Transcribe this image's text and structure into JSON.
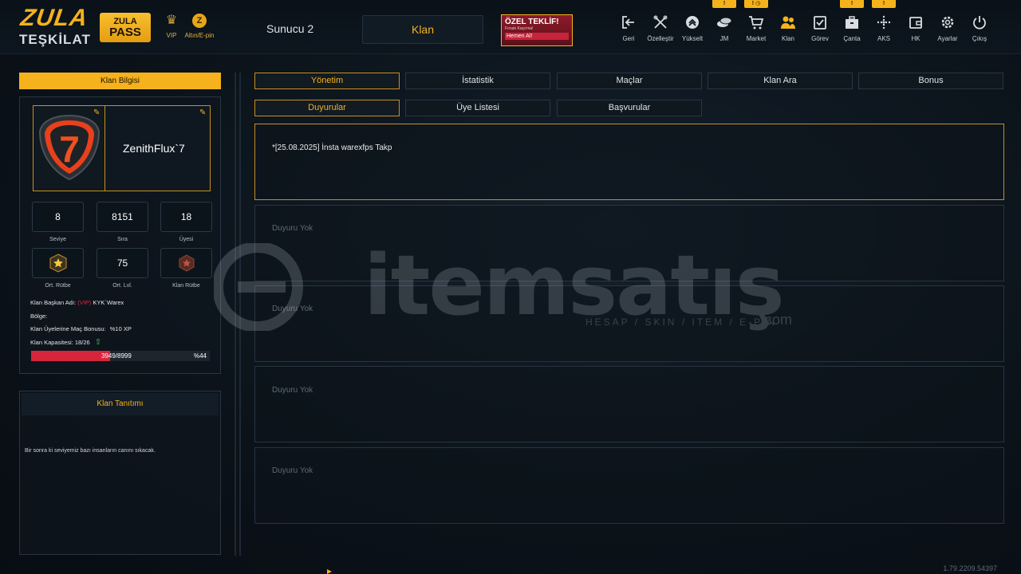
{
  "header": {
    "logo_line1": "ZULA",
    "logo_line2": "TEŞKİLAT",
    "pass_line1": "ZULA",
    "pass_line2": "PASS",
    "vip_label": "VIP",
    "gold_label": "Altın/E-pin",
    "server": "Sunucu 2",
    "active_section": "Klan",
    "offer": {
      "title": "ÖZEL TEKLİF!",
      "subtitle": "Fırsatı Kaçırma!",
      "cta": "Hemen Al!"
    },
    "nav": [
      {
        "label": "Geri",
        "icon": "exit-icon"
      },
      {
        "label": "Özelleştir",
        "icon": "tools-icon"
      },
      {
        "label": "Yükselt",
        "icon": "rank-up-icon"
      },
      {
        "label": "JM",
        "icon": "coins-icon",
        "badge": "!"
      },
      {
        "label": "Market",
        "icon": "cart-icon",
        "badge": "! ◷"
      },
      {
        "label": "Klan",
        "icon": "clan-icon"
      },
      {
        "label": "Görev",
        "icon": "task-icon"
      },
      {
        "label": "Çanta",
        "icon": "bag-icon",
        "badge": "!"
      },
      {
        "label": "AKS",
        "icon": "crosshair-icon",
        "badge": "!"
      },
      {
        "label": "HK",
        "icon": "wallet-icon"
      },
      {
        "label": "Ayarlar",
        "icon": "gear-icon"
      },
      {
        "label": "Çıkış",
        "icon": "power-icon"
      }
    ]
  },
  "clan_info": {
    "header": "Klan Bilgisi",
    "logo_number": "7",
    "name": "ZenithFlux`7",
    "stats": [
      {
        "value": "8",
        "label": "Seviye"
      },
      {
        "value": "8151",
        "label": "Sıra"
      },
      {
        "value": "18",
        "label": "Üyesi"
      }
    ],
    "stats2": [
      {
        "value": "",
        "label": "Ort. Rütbe",
        "icon": "rank-star-icon"
      },
      {
        "value": "75",
        "label": "Ort. Lvl."
      },
      {
        "value": "",
        "label": "Klan Rütbe",
        "icon": "clan-rank-icon"
      }
    ],
    "leader_label": "Klan Başkan Adı:",
    "leader_vip": "(VIP)",
    "leader_name": "KYK`Warex",
    "region_label": "Bölge:",
    "bonus_label": "Klan Üyelerine Maç Bonusu:",
    "bonus_value": "%10 XP",
    "capacity_label": "Klan Kapasitesi:",
    "capacity_value": "18/26",
    "progress_text": "3949/8999",
    "progress_pct": "%44",
    "progress_fraction": 0.44
  },
  "intro": {
    "header": "Klan Tanıtımı",
    "text": "Bir sonra ki seviyemiz bazı insanların canını sıkacak."
  },
  "tabs": [
    "Yönetim",
    "İstatistik",
    "Maçlar",
    "Klan Ara",
    "Bonus"
  ],
  "subtabs": [
    "Duyurular",
    "Üye Listesi",
    "Başvurular"
  ],
  "announcements": {
    "first": "*[25.08.2025] İnsta warexfps Takp",
    "empty_label": "Duyuru Yok"
  },
  "watermark": {
    "brand": "itemsatış",
    "tagline": "HESAP / SKIN / ITEM / E-PIN",
    "suffix": ".com"
  },
  "version": "1.79.2209.54397",
  "colors": {
    "accent": "#f5b21c",
    "danger": "#d5263c",
    "success": "#3fd45a"
  }
}
